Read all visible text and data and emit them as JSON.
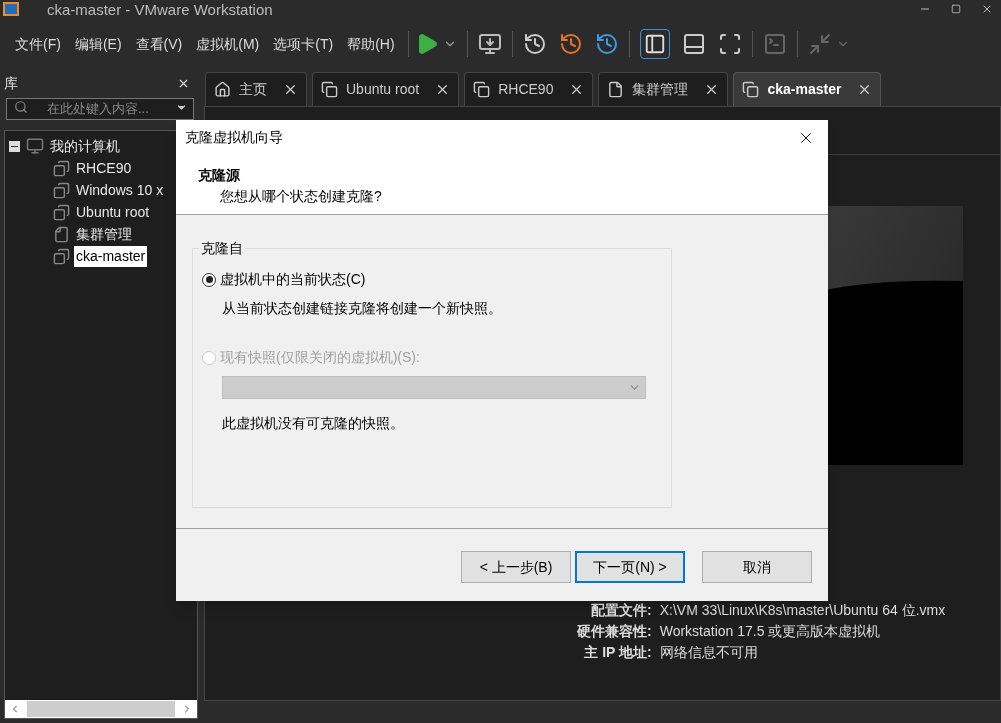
{
  "window": {
    "title": "cka-master - VMware Workstation"
  },
  "menu": [
    "文件(F)",
    "编辑(E)",
    "查看(V)",
    "虚拟机(M)",
    "选项卡(T)",
    "帮助(H)"
  ],
  "library": {
    "title": "库",
    "search_placeholder": "在此处键入内容...",
    "tree": {
      "label": "我的计算机",
      "expanded": true,
      "children": [
        {
          "label": "RHCE90",
          "kind": "vm",
          "selected": false
        },
        {
          "label": "Windows 10 x",
          "kind": "vm",
          "selected": false
        },
        {
          "label": "Ubuntu root",
          "kind": "vm",
          "selected": false
        },
        {
          "label": "集群管理",
          "kind": "folder",
          "selected": false
        },
        {
          "label": "cka-master",
          "kind": "vm",
          "selected": true
        }
      ]
    }
  },
  "tabs": [
    {
      "label": "主页",
      "kind": "home",
      "selected": false
    },
    {
      "label": "Ubuntu root",
      "kind": "vm",
      "selected": false
    },
    {
      "label": "RHCE90",
      "kind": "vm",
      "selected": false
    },
    {
      "label": "集群管理",
      "kind": "folder",
      "selected": false
    },
    {
      "label": "cka-master",
      "kind": "vm",
      "selected": true
    }
  ],
  "details": [
    {
      "label": "配置文件:",
      "value": "X:\\VM 33\\Linux\\K8s\\master\\Ubuntu 64 位.vmx"
    },
    {
      "label": "硬件兼容性:",
      "value": "Workstation 17.5 或更高版本虚拟机"
    },
    {
      "label": "主 IP 地址:",
      "value": "网络信息不可用"
    }
  ],
  "dialog": {
    "title": "克隆虚拟机向导",
    "heading": "克隆源",
    "subheading": "您想从哪个状态创建克隆?",
    "group_label": "克隆自",
    "options": [
      {
        "label": "虚拟机中的当前状态(C)",
        "selected": true,
        "disabled": false,
        "description": "从当前状态创建链接克隆将创建一个新快照。"
      },
      {
        "label": "现有快照(仅限关闭的虚拟机)(S):",
        "selected": false,
        "disabled": true,
        "dropdown": {
          "disabled": true
        },
        "note": "此虚拟机没有可克隆的快照。"
      }
    ],
    "buttons": [
      {
        "label": "< 上一步(B)",
        "kind": "back"
      },
      {
        "label": "下一页(N) >",
        "kind": "next"
      },
      {
        "label": "取消",
        "kind": "cancel"
      }
    ]
  }
}
